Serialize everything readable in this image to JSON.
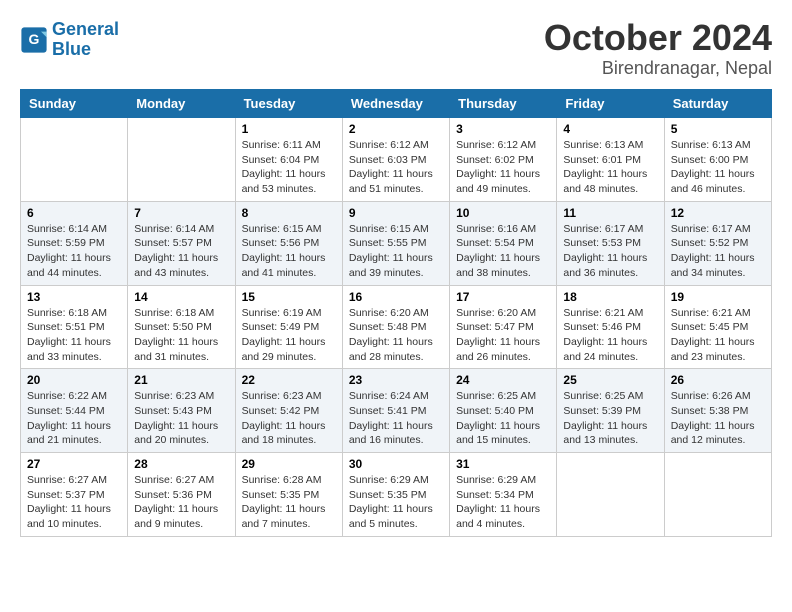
{
  "header": {
    "logo_line1": "General",
    "logo_line2": "Blue",
    "month": "October 2024",
    "location": "Birendranagar, Nepal"
  },
  "columns": [
    "Sunday",
    "Monday",
    "Tuesday",
    "Wednesday",
    "Thursday",
    "Friday",
    "Saturday"
  ],
  "rows": [
    [
      {
        "day": "",
        "content": ""
      },
      {
        "day": "",
        "content": ""
      },
      {
        "day": "1",
        "content": "Sunrise: 6:11 AM\nSunset: 6:04 PM\nDaylight: 11 hours and 53 minutes."
      },
      {
        "day": "2",
        "content": "Sunrise: 6:12 AM\nSunset: 6:03 PM\nDaylight: 11 hours and 51 minutes."
      },
      {
        "day": "3",
        "content": "Sunrise: 6:12 AM\nSunset: 6:02 PM\nDaylight: 11 hours and 49 minutes."
      },
      {
        "day": "4",
        "content": "Sunrise: 6:13 AM\nSunset: 6:01 PM\nDaylight: 11 hours and 48 minutes."
      },
      {
        "day": "5",
        "content": "Sunrise: 6:13 AM\nSunset: 6:00 PM\nDaylight: 11 hours and 46 minutes."
      }
    ],
    [
      {
        "day": "6",
        "content": "Sunrise: 6:14 AM\nSunset: 5:59 PM\nDaylight: 11 hours and 44 minutes."
      },
      {
        "day": "7",
        "content": "Sunrise: 6:14 AM\nSunset: 5:57 PM\nDaylight: 11 hours and 43 minutes."
      },
      {
        "day": "8",
        "content": "Sunrise: 6:15 AM\nSunset: 5:56 PM\nDaylight: 11 hours and 41 minutes."
      },
      {
        "day": "9",
        "content": "Sunrise: 6:15 AM\nSunset: 5:55 PM\nDaylight: 11 hours and 39 minutes."
      },
      {
        "day": "10",
        "content": "Sunrise: 6:16 AM\nSunset: 5:54 PM\nDaylight: 11 hours and 38 minutes."
      },
      {
        "day": "11",
        "content": "Sunrise: 6:17 AM\nSunset: 5:53 PM\nDaylight: 11 hours and 36 minutes."
      },
      {
        "day": "12",
        "content": "Sunrise: 6:17 AM\nSunset: 5:52 PM\nDaylight: 11 hours and 34 minutes."
      }
    ],
    [
      {
        "day": "13",
        "content": "Sunrise: 6:18 AM\nSunset: 5:51 PM\nDaylight: 11 hours and 33 minutes."
      },
      {
        "day": "14",
        "content": "Sunrise: 6:18 AM\nSunset: 5:50 PM\nDaylight: 11 hours and 31 minutes."
      },
      {
        "day": "15",
        "content": "Sunrise: 6:19 AM\nSunset: 5:49 PM\nDaylight: 11 hours and 29 minutes."
      },
      {
        "day": "16",
        "content": "Sunrise: 6:20 AM\nSunset: 5:48 PM\nDaylight: 11 hours and 28 minutes."
      },
      {
        "day": "17",
        "content": "Sunrise: 6:20 AM\nSunset: 5:47 PM\nDaylight: 11 hours and 26 minutes."
      },
      {
        "day": "18",
        "content": "Sunrise: 6:21 AM\nSunset: 5:46 PM\nDaylight: 11 hours and 24 minutes."
      },
      {
        "day": "19",
        "content": "Sunrise: 6:21 AM\nSunset: 5:45 PM\nDaylight: 11 hours and 23 minutes."
      }
    ],
    [
      {
        "day": "20",
        "content": "Sunrise: 6:22 AM\nSunset: 5:44 PM\nDaylight: 11 hours and 21 minutes."
      },
      {
        "day": "21",
        "content": "Sunrise: 6:23 AM\nSunset: 5:43 PM\nDaylight: 11 hours and 20 minutes."
      },
      {
        "day": "22",
        "content": "Sunrise: 6:23 AM\nSunset: 5:42 PM\nDaylight: 11 hours and 18 minutes."
      },
      {
        "day": "23",
        "content": "Sunrise: 6:24 AM\nSunset: 5:41 PM\nDaylight: 11 hours and 16 minutes."
      },
      {
        "day": "24",
        "content": "Sunrise: 6:25 AM\nSunset: 5:40 PM\nDaylight: 11 hours and 15 minutes."
      },
      {
        "day": "25",
        "content": "Sunrise: 6:25 AM\nSunset: 5:39 PM\nDaylight: 11 hours and 13 minutes."
      },
      {
        "day": "26",
        "content": "Sunrise: 6:26 AM\nSunset: 5:38 PM\nDaylight: 11 hours and 12 minutes."
      }
    ],
    [
      {
        "day": "27",
        "content": "Sunrise: 6:27 AM\nSunset: 5:37 PM\nDaylight: 11 hours and 10 minutes."
      },
      {
        "day": "28",
        "content": "Sunrise: 6:27 AM\nSunset: 5:36 PM\nDaylight: 11 hours and 9 minutes."
      },
      {
        "day": "29",
        "content": "Sunrise: 6:28 AM\nSunset: 5:35 PM\nDaylight: 11 hours and 7 minutes."
      },
      {
        "day": "30",
        "content": "Sunrise: 6:29 AM\nSunset: 5:35 PM\nDaylight: 11 hours and 5 minutes."
      },
      {
        "day": "31",
        "content": "Sunrise: 6:29 AM\nSunset: 5:34 PM\nDaylight: 11 hours and 4 minutes."
      },
      {
        "day": "",
        "content": ""
      },
      {
        "day": "",
        "content": ""
      }
    ]
  ]
}
